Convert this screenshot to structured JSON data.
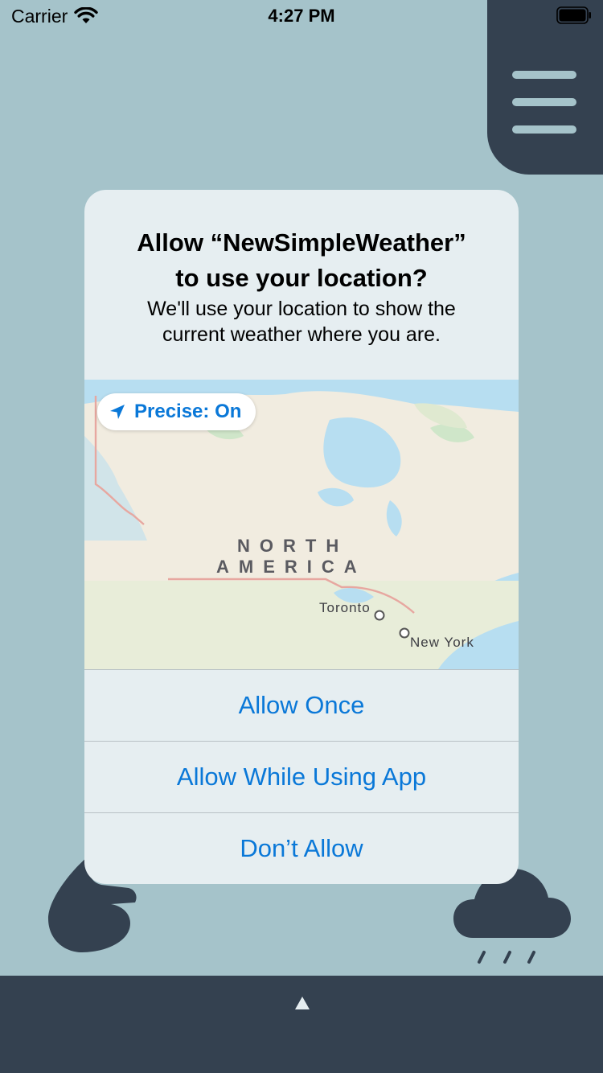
{
  "status_bar": {
    "carrier": "Carrier",
    "time": "4:27 PM"
  },
  "menu": {
    "icon": "hamburger-icon"
  },
  "alert": {
    "title": "Allow “NewSimpleWeather”\nto use your location?",
    "message": "We'll use your location to show the\ncurrent weather where you are.",
    "precise_toggle": "Precise: On",
    "map": {
      "region_line1": "NORTH",
      "region_line2": "AMERICA",
      "city1": "Toronto",
      "city2": "New York"
    },
    "buttons": {
      "allow_once": "Allow Once",
      "allow_while_using": "Allow While Using App",
      "dont_allow": "Don’t Allow"
    }
  },
  "colors": {
    "background": "#a5c3ca",
    "panel_dark": "#344150",
    "alert_bg": "#e6eef1",
    "action_blue": "#0a78d8"
  },
  "icons": {
    "wifi": "wifi-icon",
    "battery": "battery-icon",
    "location_arrow": "location-arrow-icon",
    "cloud_left": "cloud-icon",
    "cloud_rain": "rain-cloud-icon",
    "expand": "up-arrow-icon"
  }
}
